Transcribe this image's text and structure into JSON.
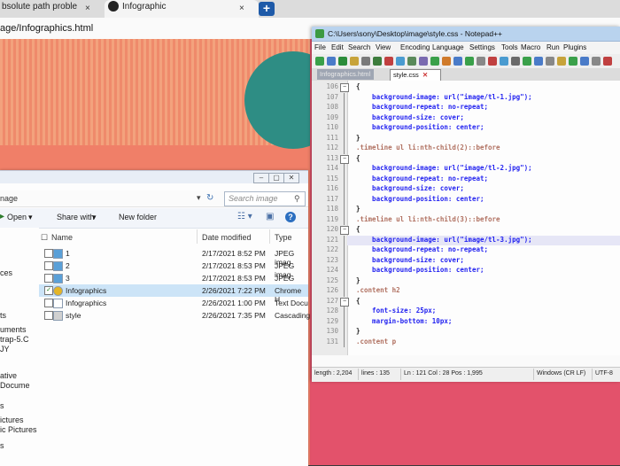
{
  "browser": {
    "tab_inactive_title": "bsolute path proble",
    "tab_inactive_close": "×",
    "tab_active_title": "Infographic",
    "tab_active_close": "×",
    "new_tab": "+",
    "url": "age/Infographics.html"
  },
  "explorer": {
    "address_text": "nage",
    "search_placeholder": "Search image",
    "toolbar": {
      "open_label": "Open",
      "share_with_label": "Share with",
      "new_folder_label": "New folder"
    },
    "columns": [
      "Name",
      "Date modified",
      "Type"
    ],
    "nav_items": [
      "ces",
      "ts",
      "uments",
      "trap-5.C",
      "JY",
      "ative",
      "Docume",
      "s",
      "ictures",
      "ic Pictures",
      "s"
    ],
    "files": [
      {
        "name": "1",
        "date": "2/17/2021 8:52 PM",
        "type": "JPEG imag",
        "selected": false,
        "checked": false,
        "icon": "image-file-icon"
      },
      {
        "name": "2",
        "date": "2/17/2021 8:53 PM",
        "type": "JPEG imag",
        "selected": false,
        "checked": false,
        "icon": "image-file-icon"
      },
      {
        "name": "3",
        "date": "2/17/2021 8:53 PM",
        "type": "JPEG imag",
        "selected": false,
        "checked": false,
        "icon": "image-file-icon"
      },
      {
        "name": "Infographics",
        "date": "2/26/2021 7:22 PM",
        "type": "Chrome H",
        "selected": true,
        "checked": true,
        "icon": "chrome-html-icon"
      },
      {
        "name": "Infographics",
        "date": "2/26/2021 1:00 PM",
        "type": "Text Docu",
        "selected": false,
        "checked": false,
        "icon": "text-file-icon"
      },
      {
        "name": "style",
        "date": "2/26/2021 7:35 PM",
        "type": "Cascading",
        "selected": false,
        "checked": false,
        "icon": "css-file-icon"
      }
    ]
  },
  "notepad": {
    "title": "C:\\Users\\sony\\Desktop\\image\\style.css - Notepad++",
    "menu": [
      "File",
      "Edit",
      "Search",
      "View",
      "Encoding",
      "Language",
      "Settings",
      "Tools",
      "Macro",
      "Run",
      "Plugins"
    ],
    "tabs": [
      "Infographics.html",
      "style.css"
    ],
    "code_lines": [
      {
        "n": "106",
        "text": "{",
        "kind": "brace"
      },
      {
        "n": "107",
        "text": "    background-image: url(\"image/tl-1.jpg\");",
        "kind": "prop"
      },
      {
        "n": "108",
        "text": "    background-repeat: no-repeat;",
        "kind": "prop"
      },
      {
        "n": "109",
        "text": "    background-size: cover;",
        "kind": "prop"
      },
      {
        "n": "110",
        "text": "    background-position: center;",
        "kind": "prop"
      },
      {
        "n": "111",
        "text": "}",
        "kind": "brace"
      },
      {
        "n": "112",
        "text": ".timeline ul li:nth-child(2)::before",
        "kind": "selector"
      },
      {
        "n": "113",
        "text": "{",
        "kind": "brace"
      },
      {
        "n": "114",
        "text": "    background-image: url(\"image/tl-2.jpg\");",
        "kind": "prop"
      },
      {
        "n": "115",
        "text": "    background-repeat: no-repeat;",
        "kind": "prop"
      },
      {
        "n": "116",
        "text": "    background-size: cover;",
        "kind": "prop"
      },
      {
        "n": "117",
        "text": "    background-position: center;",
        "kind": "prop"
      },
      {
        "n": "118",
        "text": "}",
        "kind": "brace"
      },
      {
        "n": "119",
        "text": ".timeline ul li:nth-child(3)::before",
        "kind": "selector"
      },
      {
        "n": "120",
        "text": "{",
        "kind": "brace"
      },
      {
        "n": "121",
        "text": "    background-image: url(\"image/tl-3.jpg\");",
        "kind": "prop"
      },
      {
        "n": "122",
        "text": "    background-repeat: no-repeat;",
        "kind": "prop"
      },
      {
        "n": "123",
        "text": "    background-size: cover;",
        "kind": "prop"
      },
      {
        "n": "124",
        "text": "    background-position: center;",
        "kind": "prop"
      },
      {
        "n": "125",
        "text": "}",
        "kind": "brace"
      },
      {
        "n": "126",
        "text": ".content h2",
        "kind": "selector"
      },
      {
        "n": "127",
        "text": "{",
        "kind": "brace"
      },
      {
        "n": "128",
        "text": "    font-size: 25px;",
        "kind": "prop"
      },
      {
        "n": "129",
        "text": "    margin-bottom: 10px;",
        "kind": "prop"
      },
      {
        "n": "130",
        "text": "}",
        "kind": "brace"
      },
      {
        "n": "131",
        "text": ".content p",
        "kind": "selector"
      }
    ],
    "highlighted_line": "121",
    "status": {
      "length": "length : 2,204",
      "lines": "lines : 135",
      "position": "Ln : 121    Col : 28    Pos : 1,995",
      "eol": "Windows (CR LF)",
      "encoding": "UTF-8"
    }
  },
  "colors": {
    "page_bg": "#f07f68",
    "teal_circle": "#2e8d84",
    "pink_panel": "#e3526b",
    "selection": "#cce4f7",
    "css_property": "#1f1ff0"
  }
}
